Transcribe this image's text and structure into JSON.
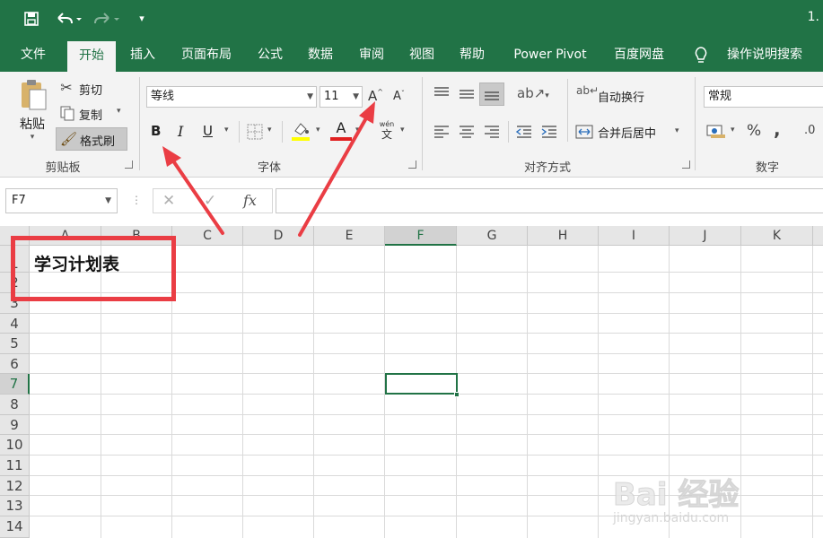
{
  "window": {
    "title": "1."
  },
  "tabs": [
    {
      "label": "文件"
    },
    {
      "label": "开始"
    },
    {
      "label": "插入"
    },
    {
      "label": "页面布局"
    },
    {
      "label": "公式"
    },
    {
      "label": "数据"
    },
    {
      "label": "审阅"
    },
    {
      "label": "视图"
    },
    {
      "label": "帮助"
    },
    {
      "label": "Power Pivot"
    },
    {
      "label": "百度网盘"
    }
  ],
  "tell_me": {
    "label": "操作说明搜索"
  },
  "clipboard": {
    "paste": "粘贴",
    "cut": "剪切",
    "copy": "复制",
    "format_painter": "格式刷",
    "group_label": "剪贴板"
  },
  "font": {
    "name": "等线",
    "size": "11",
    "bold": "B",
    "italic": "I",
    "underline": "U",
    "grow": "A",
    "shrink": "A",
    "color_letter": "A",
    "phonetic_top": "wén",
    "phonetic_bottom": "文",
    "group_label": "字体"
  },
  "alignment": {
    "wrap_text": "自动换行",
    "merge_center": "合并后居中",
    "group_label": "对齐方式"
  },
  "number": {
    "format": "常规",
    "percent": "%",
    "comma": ",",
    "decimal": ".0",
    "group_label": "数字"
  },
  "formula_bar": {
    "name_box": "F7",
    "fx": "fx",
    "value": ""
  },
  "sheet": {
    "columns": [
      "A",
      "B",
      "C",
      "D",
      "E",
      "F",
      "G",
      "H",
      "I",
      "J",
      "K"
    ],
    "selected_column": "F",
    "rows": [
      "1",
      "2",
      "3",
      "4",
      "5",
      "6",
      "7",
      "8",
      "9",
      "10",
      "11",
      "12",
      "13",
      "14"
    ],
    "selected_row": "7",
    "cell_A2": "学习计划表"
  },
  "watermark": {
    "brand": "Bai 经验",
    "url": "jingyan.baidu.com"
  },
  "colors": {
    "excel_green": "#217346",
    "annotation_red": "#ea3d44"
  }
}
